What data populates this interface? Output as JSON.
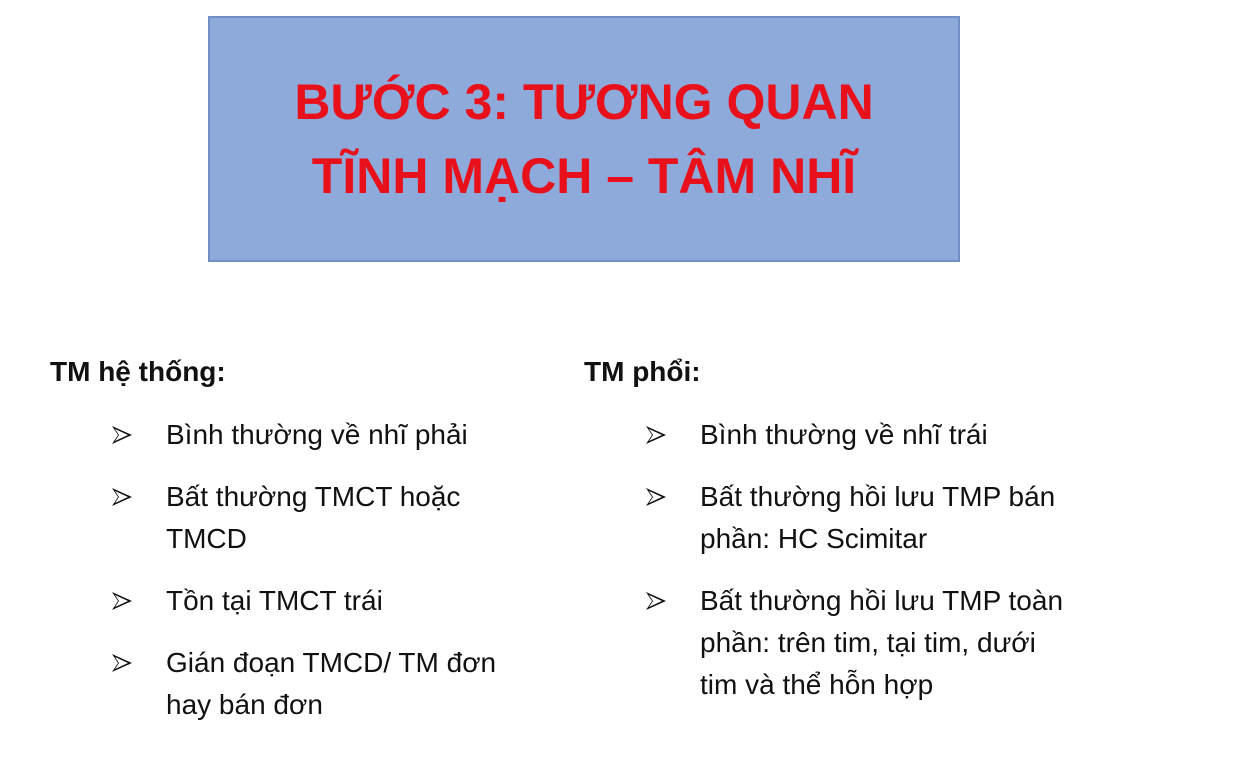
{
  "title": {
    "line1": "BƯỚC 3: TƯƠNG QUAN",
    "line2": "TĨNH MẠCH – TÂM NHĨ"
  },
  "left": {
    "heading": "TM hệ thống:",
    "items": [
      "Bình thường về nhĩ phải",
      "Bất thường TMCT hoặc\nTMCD",
      "Tồn tại TMCT trái",
      "Gián đoạn TMCD/ TM đơn\nhay bán đơn"
    ]
  },
  "right": {
    "heading": "TM phổi:",
    "items": [
      "Bình thường về nhĩ trái",
      "Bất thường hồi lưu TMP bán\nphần: HC Scimitar",
      "Bất thường hồi lưu TMP toàn\nphần: trên tim, tại tim, dưới\ntim và thể hỗn hợp"
    ]
  },
  "colors": {
    "title_bg": "#8eaadb",
    "title_text": "#e8101a",
    "body_text": "#111111"
  },
  "icons": {
    "bullet": "arrowhead-bullet-icon"
  }
}
